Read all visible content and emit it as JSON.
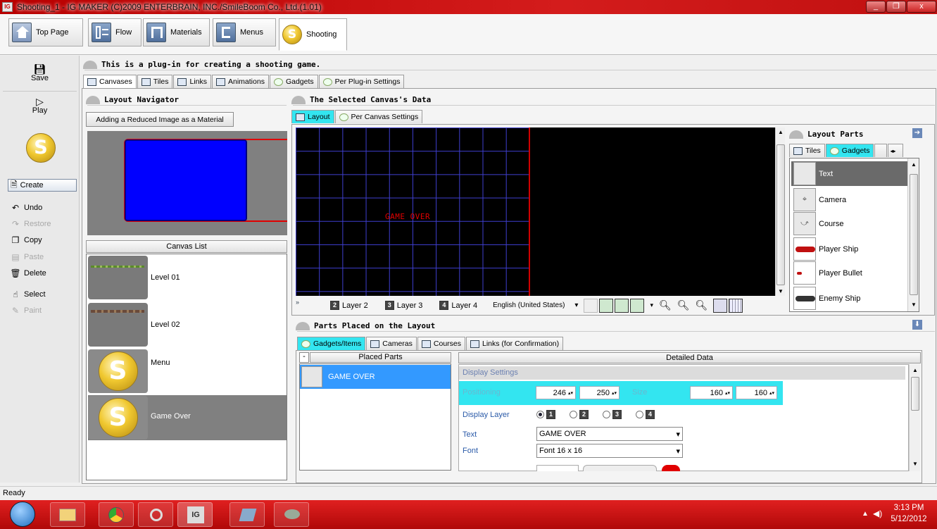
{
  "window": {
    "title": "Shooting_1 - IG MAKER (C)2009 ENTERBRAIN, INC./SmileBoom Co., Ltd.(1.01)",
    "app_icon_text": "IG",
    "minimize": "_",
    "maximize": "❐",
    "close": "x"
  },
  "top_tabs": [
    {
      "label": "Top Page"
    },
    {
      "label": "Flow"
    },
    {
      "label": "Materials"
    },
    {
      "label": "Menus"
    },
    {
      "label": "Shooting"
    }
  ],
  "left_toolbar": {
    "save": "Save",
    "play": "Play",
    "plugin_icon_letter": "S",
    "create": "Create",
    "undo": "Undo",
    "restore": "Restore",
    "copy": "Copy",
    "paste": "Paste",
    "delete": "Delete",
    "select": "Select",
    "paint": "Paint"
  },
  "plugin_banner": "This is a plug-in for creating a shooting game.",
  "main_tabs": [
    "Canvases",
    "Tiles",
    "Links",
    "Animations",
    "Gadgets",
    "Per Plug-in Settings"
  ],
  "layout_navigator": {
    "title": "Layout Navigator",
    "button": "Adding a Reduced Image as a Material"
  },
  "canvas_list": {
    "header": "Canvas List",
    "items": [
      "Level 01",
      "Level 02",
      "Menu",
      "Game Over"
    ],
    "selected": "Game Over"
  },
  "selected_canvas": {
    "title": "The Selected Canvas's Data",
    "tabs": [
      "Layout",
      "Per Canvas Settings"
    ],
    "grid_text": "GAME OVER"
  },
  "layout_toolbar": {
    "expand": "»",
    "layers": [
      {
        "num": "2",
        "label": "Layer 2"
      },
      {
        "num": "3",
        "label": "Layer 3"
      },
      {
        "num": "4",
        "label": "Layer 4"
      }
    ],
    "language": "English (United States)"
  },
  "layout_parts": {
    "title": "Layout Parts",
    "tabs": [
      "Tiles",
      "Gadgets"
    ],
    "items": [
      "Text",
      "Camera",
      "Course",
      "Player Ship",
      "Player Bullet",
      "Enemy Ship"
    ],
    "selected": "Text"
  },
  "parts_placed": {
    "title": "Parts Placed on the Layout",
    "tabs": [
      "Gadgets/Items",
      "Cameras",
      "Courses",
      "Links (for Confirmation)"
    ],
    "collapse_btn": "-",
    "placed_header": "Placed Parts",
    "placed_items": [
      "GAME OVER"
    ],
    "detail_header": "Detailed Data",
    "display_settings": "Display Settings",
    "positioning_label": "Positioning",
    "pos_x": "246",
    "pos_y": "250",
    "size_label": "Size",
    "size_w": "160",
    "size_h": "160",
    "display_layer_label": "Display Layer",
    "layer_options": [
      "1",
      "2",
      "3",
      "4"
    ],
    "selected_layer": "1",
    "text_label": "Text",
    "text_value": "GAME OVER",
    "font_label": "Font",
    "font_value": "Font 16 x 16"
  },
  "status_bar": "Ready",
  "taskbar": {
    "time": "3:13 PM",
    "date": "5/12/2012"
  },
  "colors": {
    "title_red": "#c01414",
    "selection_cyan": "#33e5f0",
    "list_selected_blue": "#3399ff",
    "grid_line": "#3f3fd0",
    "canvas_edge_red": "#e00000"
  }
}
